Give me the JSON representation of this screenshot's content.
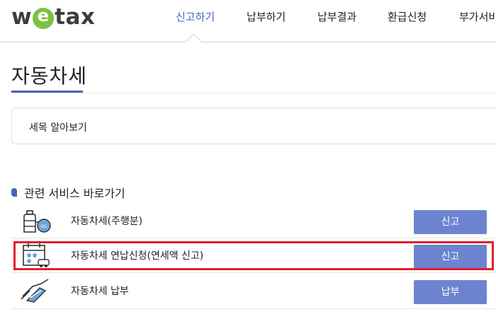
{
  "header": {
    "logo_text_prefix": "w",
    "logo_text_suffix": "tax",
    "nav": [
      {
        "label": "신고하기",
        "active": true
      },
      {
        "label": "납부하기",
        "active": false
      },
      {
        "label": "납부결과",
        "active": false
      },
      {
        "label": "환급신청",
        "active": false
      },
      {
        "label": "부가서비",
        "active": false
      }
    ]
  },
  "page": {
    "title": "자동차세",
    "info_box_label": "세목 알아보기"
  },
  "services": {
    "heading": "관련 서비스 바로가기",
    "items": [
      {
        "label": "자동차세(주행분)",
        "button": "신고",
        "icon": "fuel-tank-icon"
      },
      {
        "label": "자동차세 연납신청(연세액 신고)",
        "button": "신고",
        "icon": "calendar-car-icon"
      },
      {
        "label": "자동차세 납부",
        "button": "납부",
        "icon": "card-payment-icon"
      }
    ]
  },
  "colors": {
    "accent": "#4763b8",
    "button": "#6c84cf",
    "highlight": "#e0202a",
    "logo_green": "#7cc142"
  }
}
